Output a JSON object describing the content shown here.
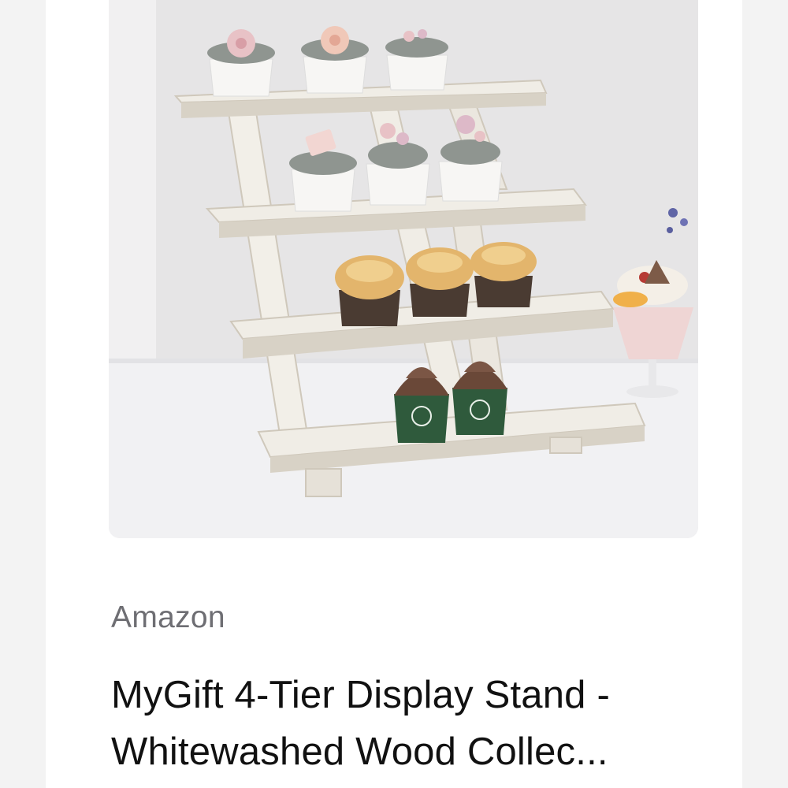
{
  "product_card": {
    "source": "Amazon",
    "title_line_1": "MyGift 4-Tier Display Stand -",
    "title_line_2": "Whitewashed Wood Collec..."
  },
  "image": {
    "subject": "4-tier whitewashed wooden display stand with cupcakes",
    "colors": {
      "wall": "#e6e5e6",
      "table": "#f1f1f3",
      "wood": "#f0ede6",
      "wood_shade": "#d8d2c6",
      "frosting_gray": "#8f9590",
      "flower_pink": "#e8c2c6",
      "muffin_top": "#e3b56c",
      "muffin_liner": "#4a3b32",
      "chocolate_frosting": "#6a4838",
      "green_liner": "#2f5a3c"
    }
  }
}
